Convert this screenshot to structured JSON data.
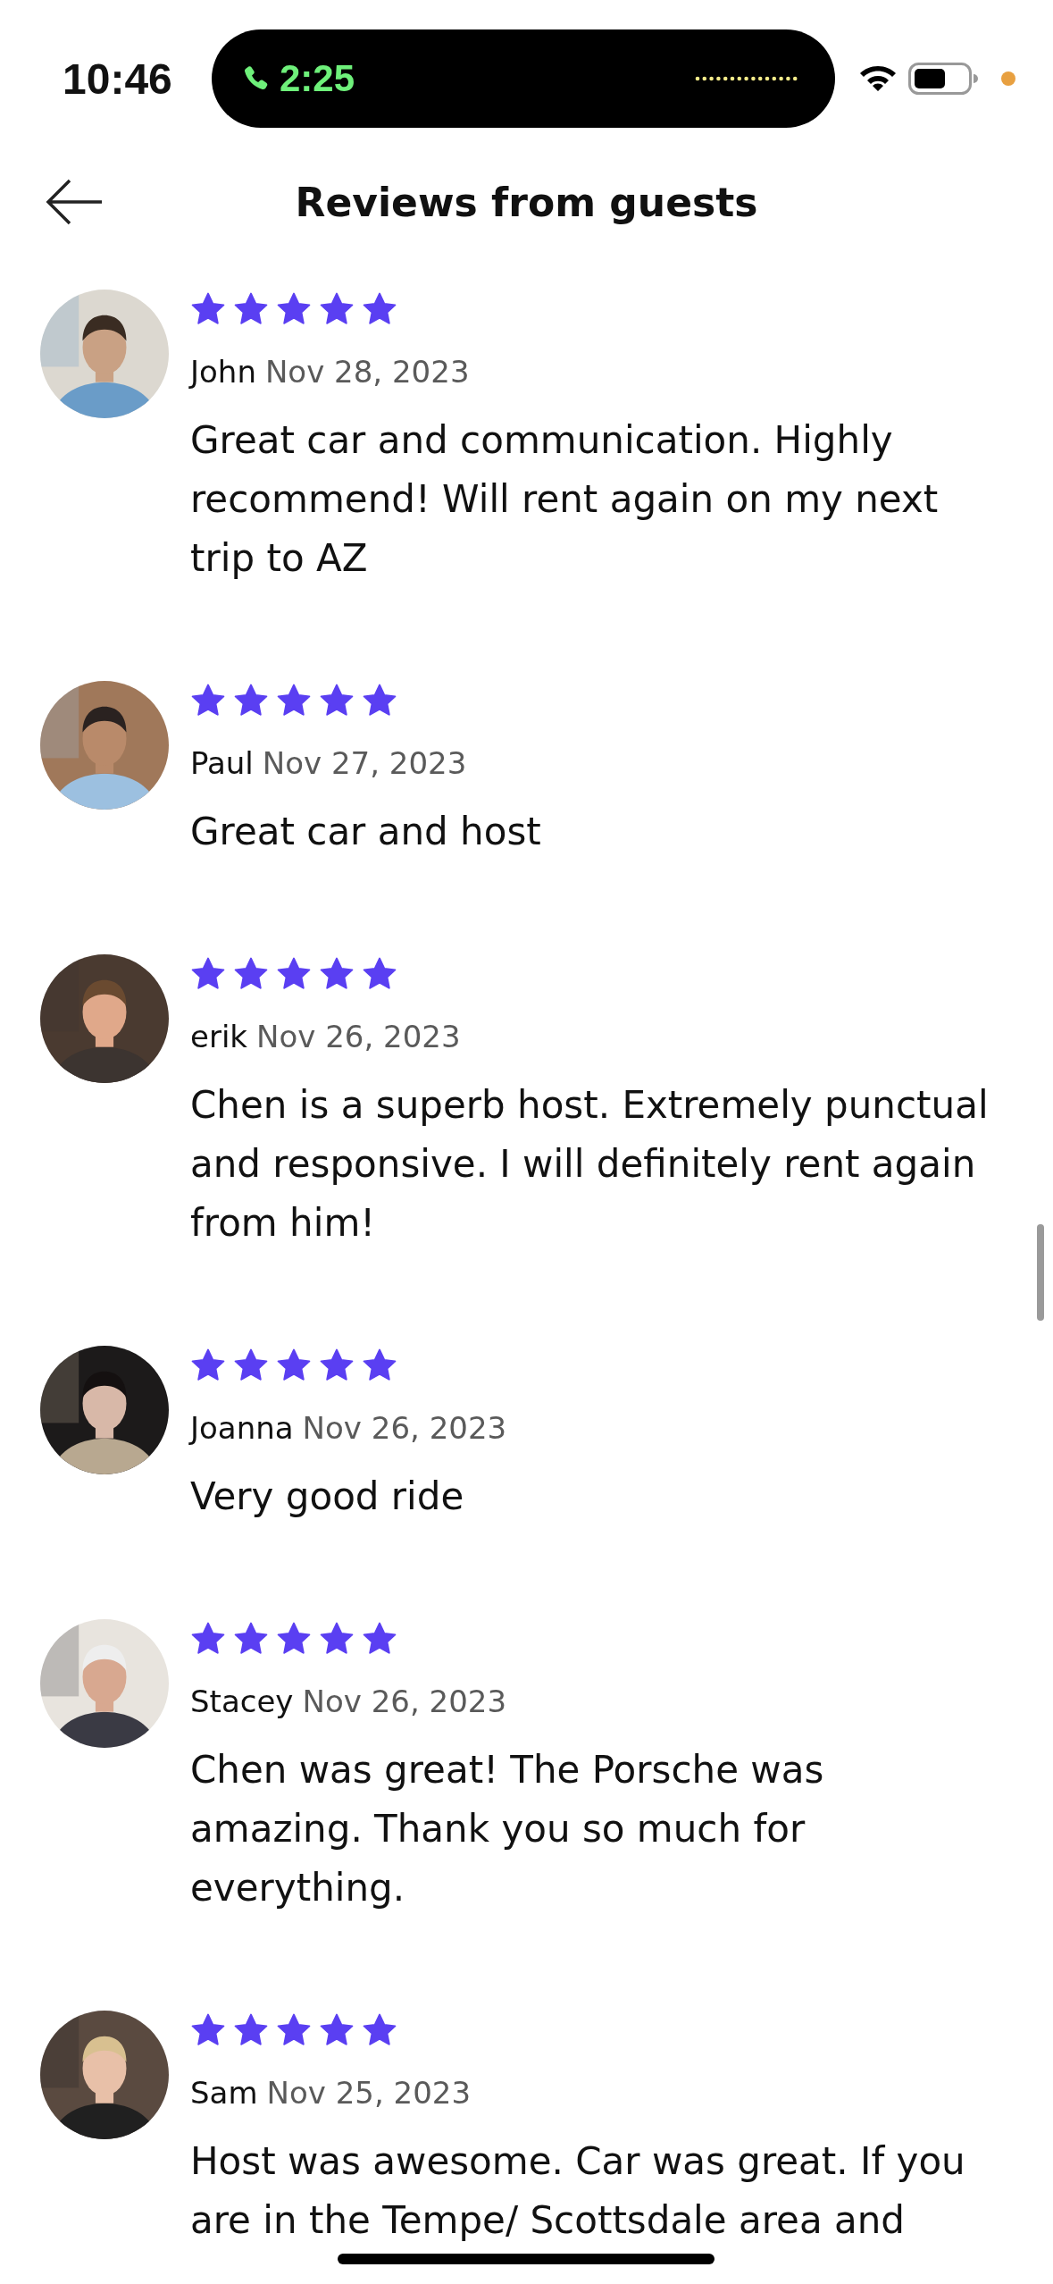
{
  "status_bar": {
    "time": "10:46",
    "call_timer": "2:25"
  },
  "header": {
    "title": "Reviews from guests"
  },
  "reviews": [
    {
      "name": "John",
      "date": "Nov 28, 2023",
      "stars": 5,
      "text": "Great car and communication. Highly recommend! Will rent again on my next trip to AZ"
    },
    {
      "name": "Paul",
      "date": "Nov 27, 2023",
      "stars": 5,
      "text": "Great car and host"
    },
    {
      "name": "erik",
      "date": "Nov 26, 2023",
      "stars": 5,
      "text": "Chen is a superb host. Extremely punctual and responsive. I will definitely rent again from him!"
    },
    {
      "name": "Joanna",
      "date": "Nov 26, 2023",
      "stars": 5,
      "text": "Very good ride"
    },
    {
      "name": "Stacey",
      "date": "Nov 26, 2023",
      "stars": 5,
      "text": "Chen was great! The Porsche was amazing. Thank you so much for everything."
    },
    {
      "name": "Sam",
      "date": "Nov 25, 2023",
      "stars": 5,
      "text": "Host was awesome. Car was great. If you are in the Tempe/ Scottsdale area and"
    }
  ]
}
